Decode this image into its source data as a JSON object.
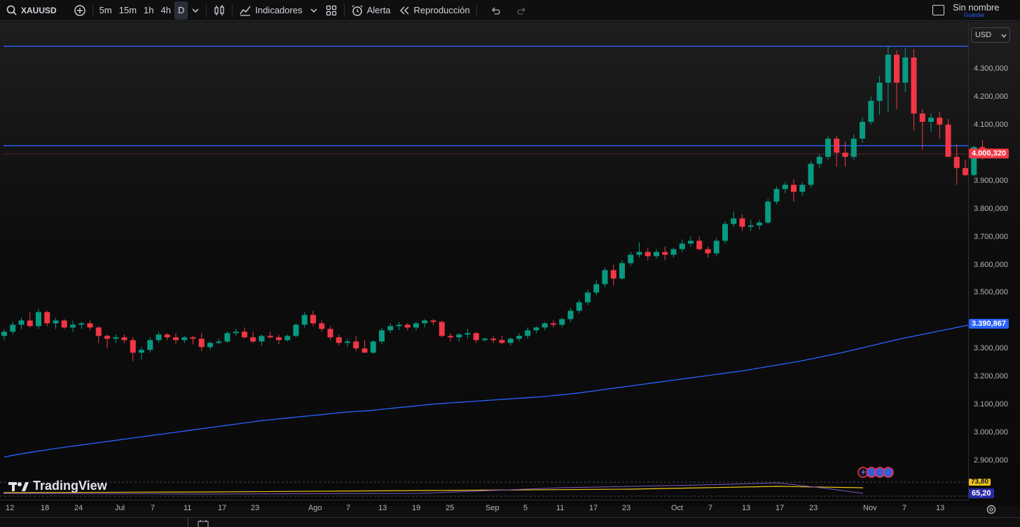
{
  "toolbar": {
    "symbol": "XAUUSD",
    "intervals": [
      "5m",
      "15m",
      "1h",
      "4h",
      "D"
    ],
    "indicators_label": "Indicadores",
    "alert_label": "Alerta",
    "replay_label": "Reproducción",
    "layout_name": "Sin nombre",
    "save_label": "Guardar"
  },
  "price_axis": {
    "currency": "USD",
    "ticks": [
      "4.300,000",
      "4.200,000",
      "4.100,000",
      "3.900,000",
      "3.800,000",
      "3.700,000",
      "3.600,000",
      "3.500,000",
      "3.300,000",
      "3.200,000",
      "3.100,000",
      "3.000,000",
      "2.900,000"
    ],
    "current_price": "4.000,320",
    "ma_price": "3.390,867",
    "osc_value_1": "73,80",
    "osc_value_2": "65,20"
  },
  "time_axis": {
    "labels": [
      "12",
      "18",
      "24",
      "Jul",
      "7",
      "11",
      "17",
      "23",
      "Ago",
      "7",
      "13",
      "19",
      "25",
      "Sep",
      "5",
      "11",
      "17",
      "23",
      "Oct",
      "7",
      "13",
      "17",
      "23",
      "Nov",
      "7",
      "13"
    ]
  },
  "brand": {
    "name": "TradingView"
  },
  "colors": {
    "up": "#089981",
    "down": "#f23645",
    "ma": "#2962ff",
    "hline": "#2962ff",
    "price_badge": "#f23645",
    "ma_badge": "#2962ff"
  },
  "chart_data": {
    "type": "candlestick",
    "symbol": "XAUUSD",
    "ylim": [
      2850,
      4400
    ],
    "hlines": [
      4380,
      4025
    ],
    "candles": [
      [
        3345,
        3370,
        3330,
        3360
      ],
      [
        3360,
        3395,
        3350,
        3385
      ],
      [
        3385,
        3410,
        3370,
        3400
      ],
      [
        3400,
        3430,
        3375,
        3380
      ],
      [
        3380,
        3440,
        3370,
        3430
      ],
      [
        3430,
        3435,
        3380,
        3390
      ],
      [
        3390,
        3410,
        3370,
        3400
      ],
      [
        3400,
        3405,
        3370,
        3375
      ],
      [
        3375,
        3400,
        3360,
        3385
      ],
      [
        3385,
        3395,
        3370,
        3390
      ],
      [
        3390,
        3400,
        3365,
        3375
      ],
      [
        3375,
        3380,
        3320,
        3345
      ],
      [
        3345,
        3350,
        3300,
        3335
      ],
      [
        3335,
        3350,
        3320,
        3340
      ],
      [
        3340,
        3350,
        3320,
        3330
      ],
      [
        3330,
        3340,
        3255,
        3285
      ],
      [
        3285,
        3305,
        3260,
        3295
      ],
      [
        3295,
        3340,
        3285,
        3330
      ],
      [
        3330,
        3360,
        3320,
        3350
      ],
      [
        3350,
        3355,
        3330,
        3340
      ],
      [
        3340,
        3355,
        3315,
        3330
      ],
      [
        3330,
        3345,
        3320,
        3340
      ],
      [
        3340,
        3345,
        3315,
        3335
      ],
      [
        3335,
        3355,
        3290,
        3305
      ],
      [
        3305,
        3325,
        3295,
        3320
      ],
      [
        3320,
        3335,
        3315,
        3325
      ],
      [
        3325,
        3360,
        3320,
        3355
      ],
      [
        3355,
        3370,
        3345,
        3360
      ],
      [
        3360,
        3375,
        3335,
        3340
      ],
      [
        3340,
        3360,
        3320,
        3325
      ],
      [
        3325,
        3350,
        3310,
        3345
      ],
      [
        3345,
        3360,
        3335,
        3340
      ],
      [
        3340,
        3350,
        3315,
        3330
      ],
      [
        3330,
        3350,
        3325,
        3345
      ],
      [
        3345,
        3390,
        3340,
        3385
      ],
      [
        3385,
        3430,
        3375,
        3420
      ],
      [
        3420,
        3435,
        3380,
        3390
      ],
      [
        3390,
        3400,
        3360,
        3370
      ],
      [
        3370,
        3380,
        3330,
        3340
      ],
      [
        3340,
        3350,
        3310,
        3320
      ],
      [
        3320,
        3335,
        3305,
        3325
      ],
      [
        3325,
        3345,
        3290,
        3300
      ],
      [
        3300,
        3330,
        3285,
        3285
      ],
      [
        3285,
        3330,
        3280,
        3325
      ],
      [
        3325,
        3375,
        3315,
        3365
      ],
      [
        3365,
        3390,
        3355,
        3380
      ],
      [
        3380,
        3395,
        3365,
        3385
      ],
      [
        3385,
        3390,
        3365,
        3375
      ],
      [
        3375,
        3395,
        3365,
        3390
      ],
      [
        3390,
        3405,
        3375,
        3400
      ],
      [
        3400,
        3405,
        3385,
        3395
      ],
      [
        3395,
        3400,
        3340,
        3345
      ],
      [
        3345,
        3355,
        3325,
        3340
      ],
      [
        3340,
        3355,
        3325,
        3350
      ],
      [
        3350,
        3370,
        3335,
        3355
      ],
      [
        3355,
        3360,
        3320,
        3330
      ],
      [
        3330,
        3340,
        3325,
        3335
      ],
      [
        3335,
        3345,
        3320,
        3330
      ],
      [
        3330,
        3345,
        3315,
        3320
      ],
      [
        3320,
        3340,
        3310,
        3335
      ],
      [
        3335,
        3355,
        3325,
        3345
      ],
      [
        3345,
        3375,
        3335,
        3365
      ],
      [
        3365,
        3380,
        3355,
        3375
      ],
      [
        3375,
        3395,
        3365,
        3390
      ],
      [
        3390,
        3400,
        3375,
        3385
      ],
      [
        3385,
        3410,
        3375,
        3405
      ],
      [
        3405,
        3445,
        3395,
        3435
      ],
      [
        3435,
        3475,
        3425,
        3465
      ],
      [
        3465,
        3510,
        3455,
        3500
      ],
      [
        3500,
        3545,
        3490,
        3530
      ],
      [
        3530,
        3590,
        3520,
        3580
      ],
      [
        3580,
        3600,
        3525,
        3550
      ],
      [
        3550,
        3615,
        3545,
        3605
      ],
      [
        3605,
        3645,
        3595,
        3635
      ],
      [
        3635,
        3680,
        3625,
        3645
      ],
      [
        3645,
        3660,
        3615,
        3630
      ],
      [
        3630,
        3655,
        3620,
        3645
      ],
      [
        3645,
        3665,
        3615,
        3635
      ],
      [
        3635,
        3660,
        3625,
        3655
      ],
      [
        3655,
        3690,
        3645,
        3675
      ],
      [
        3675,
        3700,
        3665,
        3685
      ],
      [
        3685,
        3700,
        3650,
        3655
      ],
      [
        3655,
        3665,
        3625,
        3640
      ],
      [
        3640,
        3695,
        3630,
        3685
      ],
      [
        3685,
        3755,
        3675,
        3745
      ],
      [
        3745,
        3790,
        3735,
        3765
      ],
      [
        3765,
        3780,
        3720,
        3735
      ],
      [
        3735,
        3760,
        3720,
        3740
      ],
      [
        3740,
        3760,
        3725,
        3750
      ],
      [
        3750,
        3835,
        3745,
        3825
      ],
      [
        3825,
        3880,
        3815,
        3870
      ],
      [
        3870,
        3895,
        3855,
        3885
      ],
      [
        3885,
        3905,
        3825,
        3860
      ],
      [
        3860,
        3895,
        3845,
        3885
      ],
      [
        3885,
        3970,
        3875,
        3960
      ],
      [
        3960,
        3995,
        3945,
        3985
      ],
      [
        3985,
        4060,
        3975,
        4050
      ],
      [
        4050,
        4060,
        3950,
        4000
      ],
      [
        4000,
        4040,
        3950,
        3985
      ],
      [
        3985,
        4065,
        3975,
        4050
      ],
      [
        4050,
        4125,
        4035,
        4110
      ],
      [
        4110,
        4200,
        4100,
        4185
      ],
      [
        4185,
        4275,
        4135,
        4250
      ],
      [
        4250,
        4380,
        4145,
        4350
      ],
      [
        4350,
        4365,
        4155,
        4250
      ],
      [
        4250,
        4375,
        4215,
        4340
      ],
      [
        4340,
        4370,
        4080,
        4140
      ],
      [
        4140,
        4155,
        4010,
        4110
      ],
      [
        4110,
        4140,
        4075,
        4125
      ],
      [
        4125,
        4145,
        4050,
        4100
      ],
      [
        4100,
        4120,
        3985,
        3985
      ],
      [
        3985,
        4030,
        3885,
        3945
      ],
      [
        3945,
        3975,
        3915,
        3920
      ],
      [
        3920,
        4025,
        3915,
        4020
      ],
      [
        4020,
        4045,
        3975,
        3995
      ]
    ],
    "ma_series": [
      2912,
      2918,
      2923,
      2928,
      2933,
      2937,
      2942,
      2946,
      2950,
      2954,
      2958,
      2962,
      2966,
      2970,
      2974,
      2978,
      2982,
      2986,
      2990,
      2994,
      2998,
      3002,
      3006,
      3010,
      3014,
      3018,
      3022,
      3026,
      3030,
      3034,
      3038,
      3042,
      3045,
      3048,
      3051,
      3054,
      3057,
      3060,
      3063,
      3066,
      3069,
      3072,
      3074,
      3076,
      3078,
      3081,
      3084,
      3087,
      3090,
      3093,
      3096,
      3099,
      3102,
      3104,
      3106,
      3108,
      3110,
      3112,
      3114,
      3116,
      3118,
      3120,
      3122,
      3124,
      3126,
      3128,
      3131,
      3134,
      3137,
      3140,
      3144,
      3148,
      3152,
      3156,
      3160,
      3164,
      3168,
      3172,
      3176,
      3180,
      3184,
      3188,
      3192,
      3196,
      3200,
      3204,
      3208,
      3212,
      3216,
      3220,
      3225,
      3230,
      3235,
      3240,
      3245,
      3250,
      3255,
      3261,
      3267,
      3273,
      3279,
      3285,
      3292,
      3299,
      3306,
      3313,
      3320,
      3327,
      3334,
      3340,
      3346,
      3352,
      3358,
      3364,
      3370,
      3376,
      3382,
      3387,
      3391
    ]
  }
}
